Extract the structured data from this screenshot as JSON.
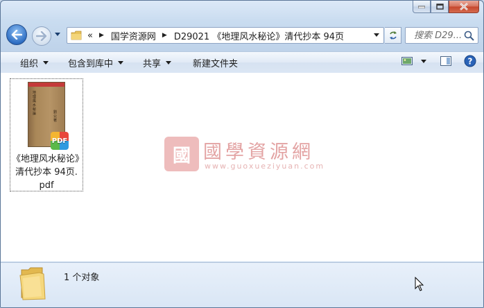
{
  "window": {
    "caption_buttons": [
      "minimize",
      "maximize",
      "close"
    ]
  },
  "address": {
    "overflow": "«",
    "crumbs": [
      "国学资源网",
      "D29021 《地理风水秘论》清代抄本 94页"
    ]
  },
  "search": {
    "placeholder": "搜索 D29..."
  },
  "toolbar": {
    "organize": "组织",
    "include_library": "包含到库中",
    "share": "共享",
    "new_folder": "新建文件夹"
  },
  "file": {
    "name_lines": [
      "《地理风水秘论》",
      "清代抄本 94页.",
      "pdf"
    ],
    "badge": "PDF",
    "thumb_text": [
      "地理風水秘論",
      "劉公著"
    ]
  },
  "watermark": {
    "logo_char": "國",
    "title": "國學資源網",
    "url": "www.guoxueziyuan.com"
  },
  "status": {
    "count": "1 个对象"
  },
  "colors": {
    "titlebar": "#c9dcf0",
    "close_button": "#c6462c",
    "watermark": "#e3a3a3",
    "pdf_badge": [
      "#e8463b",
      "#2f9ae0",
      "#5bb94a",
      "#f4b531"
    ]
  }
}
